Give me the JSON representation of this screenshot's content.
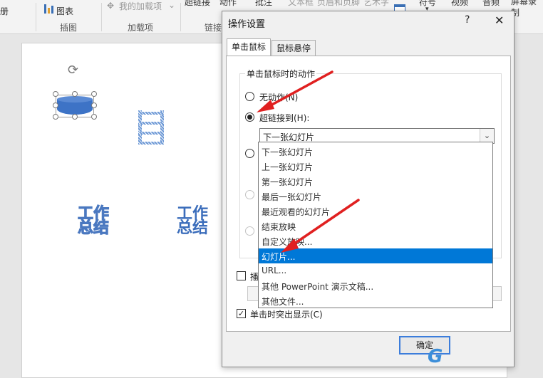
{
  "ribbon": {
    "left_item": "册",
    "chart_label": "图表",
    "addins_label": "我的加载项",
    "hyperlink_label": "超链接",
    "action_label": "动作",
    "comment_label": "批注",
    "textbox_label": "文本框",
    "header_footer_label": "页眉和页脚",
    "wordart_label": "艺术字",
    "symbol_label": "符号",
    "video_label": "视频",
    "audio_label": "音频",
    "screen_record_label": "屏幕录制",
    "groups": {
      "illustrations": "插图",
      "addins": "加载项",
      "links": "链接"
    }
  },
  "slide": {
    "wordart1": "工作总结",
    "wordart2": "工作总结"
  },
  "dialog": {
    "title": "操作设置",
    "help": "?",
    "close": "✕",
    "tabs": [
      "单击鼠标",
      "鼠标悬停"
    ],
    "group_title": "单击鼠标时的动作",
    "options": {
      "none": "无动作(N)",
      "hyperlink": "超链接到(H):"
    },
    "combo_value": "下一张幻灯片",
    "checkbox_play_sound": "播",
    "checkbox_highlight": "单击时突出显示(C)",
    "ok": "确定"
  },
  "dropdown": {
    "items": [
      "下一张幻灯片",
      "上一张幻灯片",
      "第一张幻灯片",
      "最后一张幻灯片",
      "最近观看的幻灯片",
      "结束放映",
      "自定义放映...",
      "幻灯片...",
      "URL...",
      "其他 PowerPoint 演示文稿...",
      "其他文件..."
    ],
    "selected_index": 7
  },
  "colors": {
    "accent": "#0078d7",
    "arrow": "#e02020",
    "shape_blue": "#3d73c6"
  },
  "icons": [
    "chart-icon",
    "puzzle-icon",
    "rotate-icon",
    "help-icon",
    "close-icon",
    "chevron-down-icon",
    "check-icon"
  ]
}
